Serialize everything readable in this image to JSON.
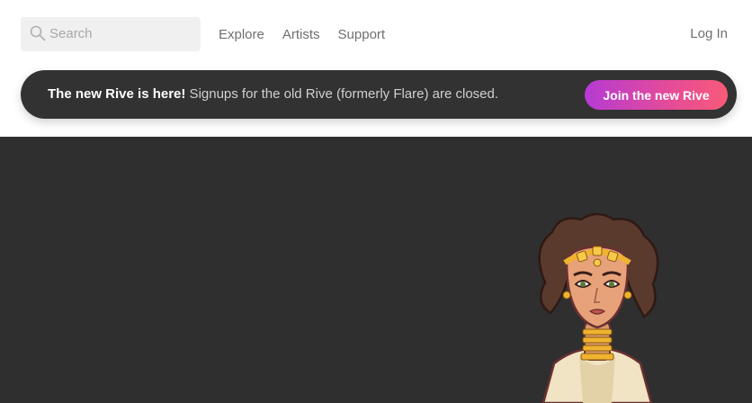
{
  "header": {
    "search_placeholder": "Search",
    "nav": [
      "Explore",
      "Artists",
      "Support"
    ],
    "login_label": "Log In"
  },
  "banner": {
    "headline": "The new Rive is here!",
    "message": " Signups for the old Rive (formerly Flare) are closed.",
    "cta_label": "Join the new Rive"
  },
  "colors": {
    "banner_bg": "#323232",
    "hero_bg": "#2f2f2f",
    "cta_gradient_start": "#b53bd4",
    "cta_gradient_end": "#f85a78"
  },
  "hero": {
    "illustration": "character-illustration"
  }
}
